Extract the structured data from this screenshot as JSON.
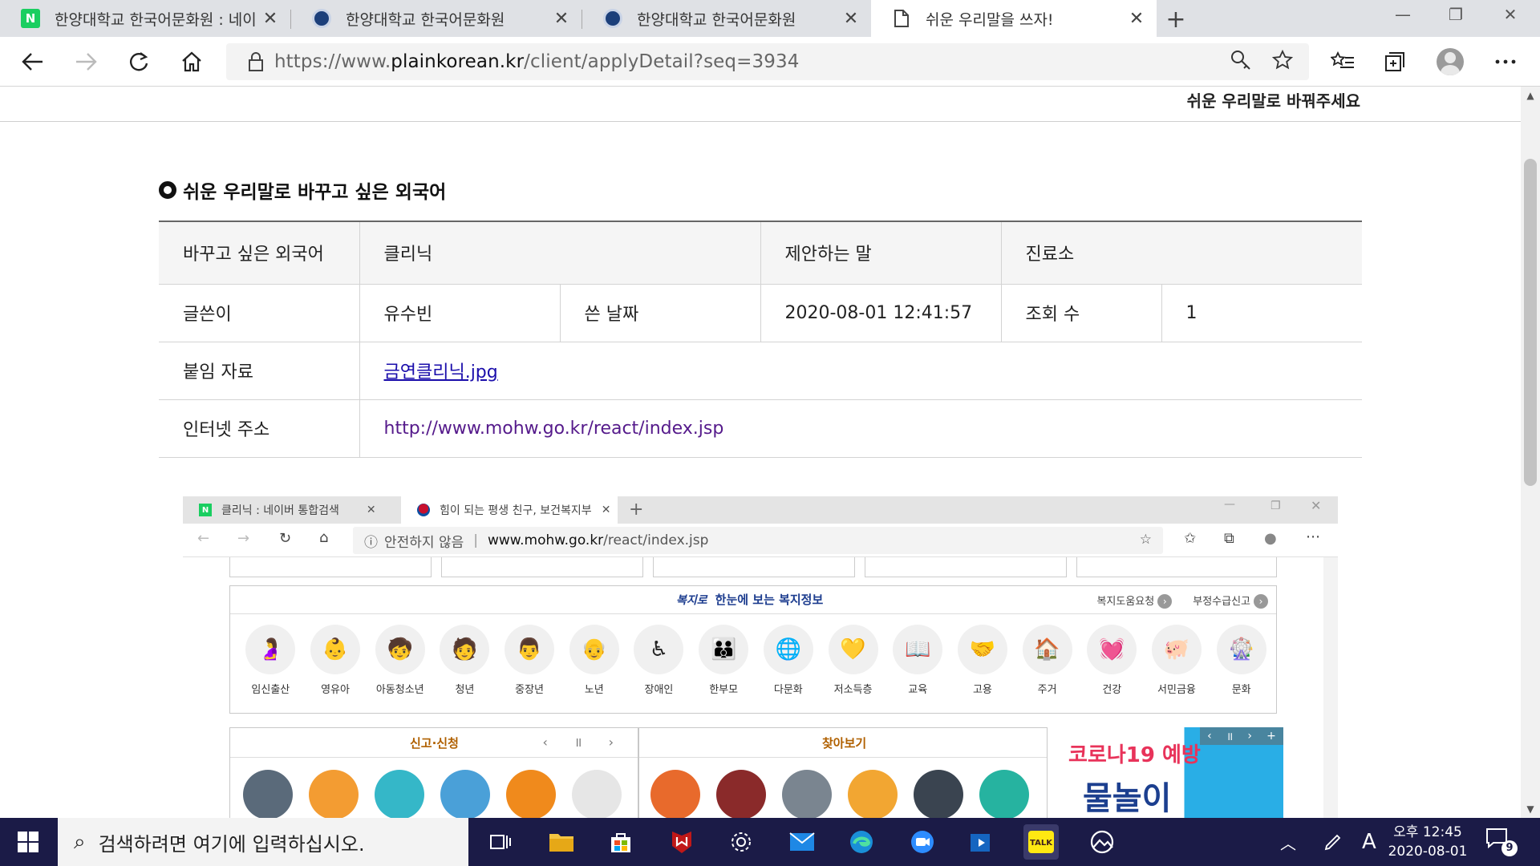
{
  "browser": {
    "tabs": [
      {
        "title": "한양대학교 한국어문화원 : 네이",
        "favicon": "naver-icon"
      },
      {
        "title": "한양대학교 한국어문화원",
        "favicon": "hanyang-icon"
      },
      {
        "title": "한양대학교 한국어문화원",
        "favicon": "hanyang-icon"
      },
      {
        "title": "쉬운 우리말을 쓰자!",
        "favicon": "page-icon"
      }
    ],
    "close_glyph": "✕",
    "new_tab_glyph": "+",
    "url_prefix": "https://www.",
    "url_domain": "plainkorean.kr",
    "url_path": "/client/applyDetail?seq=3934"
  },
  "page": {
    "top_strip_text": "쉬운 우리말로 바꿔주세요",
    "section_title": "쉬운 우리말로 바꾸고 싶은 외국어",
    "table": {
      "foreign_word_label": "바꾸고 싶은 외국어",
      "foreign_word": "클리닉",
      "suggestion_label": "제안하는 말",
      "suggestion": "진료소",
      "author_label": "글쓴이",
      "author": "유수빈",
      "date_label": "쓴 날짜",
      "date": "2020-08-01 12:41:57",
      "views_label": "조회 수",
      "views": "1",
      "attachment_label": "붙임 자료",
      "attachment": "금연클리닉.jpg",
      "internet_label": "인터넷 주소",
      "internet": "http://www.mohw.go.kr/react/index.jsp"
    }
  },
  "embedded": {
    "tabs": [
      {
        "title": "클리닉 : 네이버 통합검색"
      },
      {
        "title": "힘이 되는 평생 친구, 보건복지부"
      }
    ],
    "insecure_label": "안전하지 않음",
    "url_domain": "www.mohw.go.kr",
    "url_path": "/react/index.jsp",
    "welfare_logo": "복지로",
    "welfare_title": "한눈에 보는 복지정보",
    "welfare_links": [
      "복지도움요청",
      "부정수급신고"
    ],
    "categories": [
      {
        "label": "임신출산",
        "icon": "pregnancy-icon"
      },
      {
        "label": "영유아",
        "icon": "infant-icon"
      },
      {
        "label": "아동청소년",
        "icon": "child-icon"
      },
      {
        "label": "청년",
        "icon": "youth-icon"
      },
      {
        "label": "중장년",
        "icon": "middle-age-icon"
      },
      {
        "label": "노년",
        "icon": "elderly-icon"
      },
      {
        "label": "장애인",
        "icon": "disabled-icon"
      },
      {
        "label": "한부모",
        "icon": "single-parent-icon"
      },
      {
        "label": "다문화",
        "icon": "globe-icon"
      },
      {
        "label": "저소득층",
        "icon": "heart-hand-icon"
      },
      {
        "label": "교육",
        "icon": "book-icon"
      },
      {
        "label": "고용",
        "icon": "handshake-icon"
      },
      {
        "label": "주거",
        "icon": "house-icon"
      },
      {
        "label": "건강",
        "icon": "heart-pulse-icon"
      },
      {
        "label": "서민금융",
        "icon": "piggy-bank-icon"
      },
      {
        "label": "문화",
        "icon": "ferris-wheel-icon"
      }
    ],
    "report_title": "신고·신청",
    "lookup_title": "찾아보기",
    "banner_line1": "코로나19 예방",
    "banner_line2": "물놀이"
  },
  "taskbar": {
    "search_placeholder": "검색하려면 여기에 입력하십시오.",
    "ime_label": "A",
    "time": "오후 12:45",
    "date": "2020-08-01",
    "notification_count": "9"
  },
  "colors": {
    "tabbar": "#dfe1e5",
    "taskbar": "#1b1b47",
    "link": "#1a0dab",
    "visited_link": "#551a8b",
    "welfare_blue": "#1d3d8f"
  }
}
